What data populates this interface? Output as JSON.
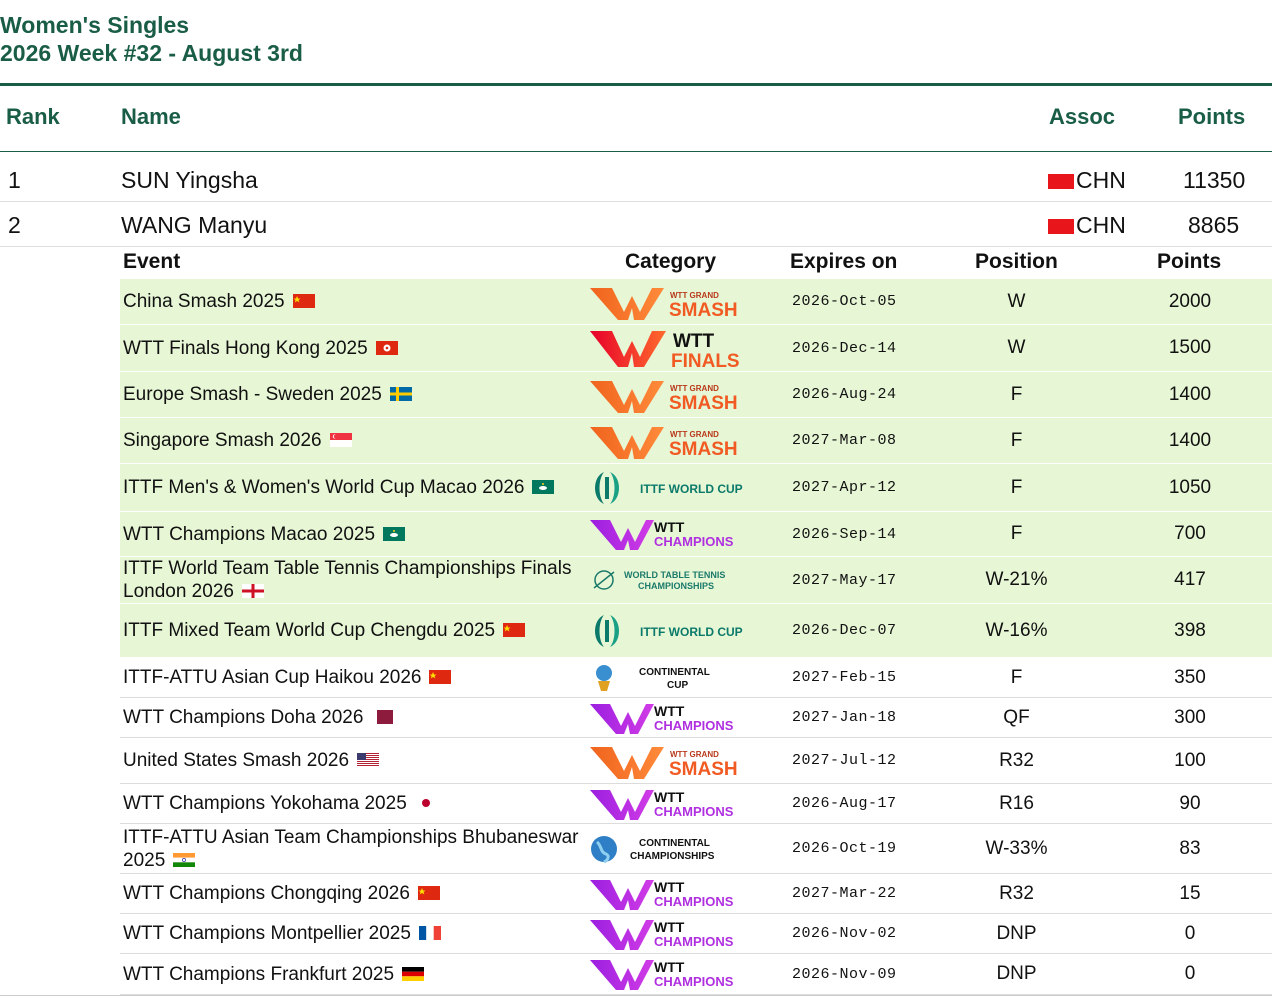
{
  "page": {
    "title_line1": "Women's Singles",
    "title_line2": "2026 Week #32 - August 3rd",
    "accent_color": "#1a5d47",
    "highlight_color": "#e7f6d5"
  },
  "headers": {
    "rank": "Rank",
    "name": "Name",
    "assoc": "Assoc",
    "points": "Points"
  },
  "players": [
    {
      "rank": "1",
      "name": "SUN Yingsha",
      "assoc": "CHN",
      "points": "11350"
    },
    {
      "rank": "2",
      "name": "WANG Manyu",
      "assoc": "CHN",
      "points": "8865"
    }
  ],
  "events_headers": {
    "event": "Event",
    "category": "Category",
    "expires": "Expires on",
    "position": "Position",
    "points": "Points"
  },
  "events": [
    {
      "name": "China Smash 2025",
      "flag": "china-flag",
      "category": "wtt-grand-smash-logo",
      "expires": "2026-Oct-05",
      "position": "W",
      "points": "2000",
      "highlighted": true
    },
    {
      "name": "WTT Finals Hong Kong 2025",
      "flag": "hong-kong-flag",
      "category": "wtt-finals-logo",
      "expires": "2026-Dec-14",
      "position": "W",
      "points": "1500",
      "highlighted": true
    },
    {
      "name": "Europe Smash - Sweden 2025",
      "flag": "sweden-flag",
      "category": "wtt-grand-smash-logo",
      "expires": "2026-Aug-24",
      "position": "F",
      "points": "1400",
      "highlighted": true
    },
    {
      "name": "Singapore Smash 2026",
      "flag": "singapore-flag",
      "category": "wtt-grand-smash-logo",
      "expires": "2027-Mar-08",
      "position": "F",
      "points": "1400",
      "highlighted": true
    },
    {
      "name": "ITTF Men's & Women's World Cup Macao 2026",
      "flag": "macao-flag",
      "category": "ittf-world-cup-logo",
      "expires": "2027-Apr-12",
      "position": "F",
      "points": "1050",
      "highlighted": true
    },
    {
      "name": "WTT Champions Macao 2025",
      "flag": "macao-flag",
      "category": "wtt-champions-logo",
      "expires": "2026-Sep-14",
      "position": "F",
      "points": "700",
      "highlighted": true
    },
    {
      "name": "ITTF World Team Table Tennis Championships Finals London 2026",
      "flag": "england-flag",
      "category": "world-table-tennis-championships-logo",
      "expires": "2027-May-17",
      "position": "W-21%",
      "points": "417",
      "highlighted": true
    },
    {
      "name": "ITTF Mixed Team World Cup Chengdu 2025",
      "flag": "china-flag",
      "category": "ittf-world-cup-logo",
      "expires": "2026-Dec-07",
      "position": "W-16%",
      "points": "398",
      "highlighted": true
    },
    {
      "name": "ITTF-ATTU Asian Cup Haikou 2026",
      "flag": "china-flag",
      "category": "continental-cup-logo",
      "expires": "2027-Feb-15",
      "position": "F",
      "points": "350",
      "highlighted": false
    },
    {
      "name": "WTT Champions Doha 2026",
      "flag": "qatar-flag",
      "category": "wtt-champions-logo",
      "expires": "2027-Jan-18",
      "position": "QF",
      "points": "300",
      "highlighted": false
    },
    {
      "name": "United States Smash 2026",
      "flag": "usa-flag",
      "category": "wtt-grand-smash-logo",
      "expires": "2027-Jul-12",
      "position": "R32",
      "points": "100",
      "highlighted": false
    },
    {
      "name": "WTT Champions Yokohama 2025",
      "flag": "japan-flag",
      "category": "wtt-champions-logo",
      "expires": "2026-Aug-17",
      "position": "R16",
      "points": "90",
      "highlighted": false
    },
    {
      "name": "ITTF-ATTU Asian Team Championships Bhubaneswar 2025",
      "flag": "india-flag",
      "category": "continental-championships-logo",
      "expires": "2026-Oct-19",
      "position": "W-33%",
      "points": "83",
      "highlighted": false
    },
    {
      "name": "WTT Champions Chongqing 2026",
      "flag": "china-flag",
      "category": "wtt-champions-logo",
      "expires": "2027-Mar-22",
      "position": "R32",
      "points": "15",
      "highlighted": false
    },
    {
      "name": "WTT Champions Montpellier 2025",
      "flag": "france-flag",
      "category": "wtt-champions-logo",
      "expires": "2026-Nov-02",
      "position": "DNP",
      "points": "0",
      "highlighted": false
    },
    {
      "name": "WTT Champions Frankfurt 2025",
      "flag": "germany-flag",
      "category": "wtt-champions-logo",
      "expires": "2026-Nov-09",
      "position": "DNP",
      "points": "0",
      "highlighted": false
    }
  ],
  "logo_text": {
    "wtt_grand": "WTT GRAND",
    "smash": "SMASH",
    "wtt": "WTT",
    "finals": "FINALS",
    "champions": "CHAMPIONS",
    "ittf_world_cup": "ITTF WORLD CUP",
    "wttc_line1": "WORLD TABLE TENNIS",
    "wttc_line2": "CHAMPIONSHIPS",
    "continental": "CONTINENTAL",
    "cup": "CUP",
    "championships": "CHAMPIONSHIPS"
  }
}
